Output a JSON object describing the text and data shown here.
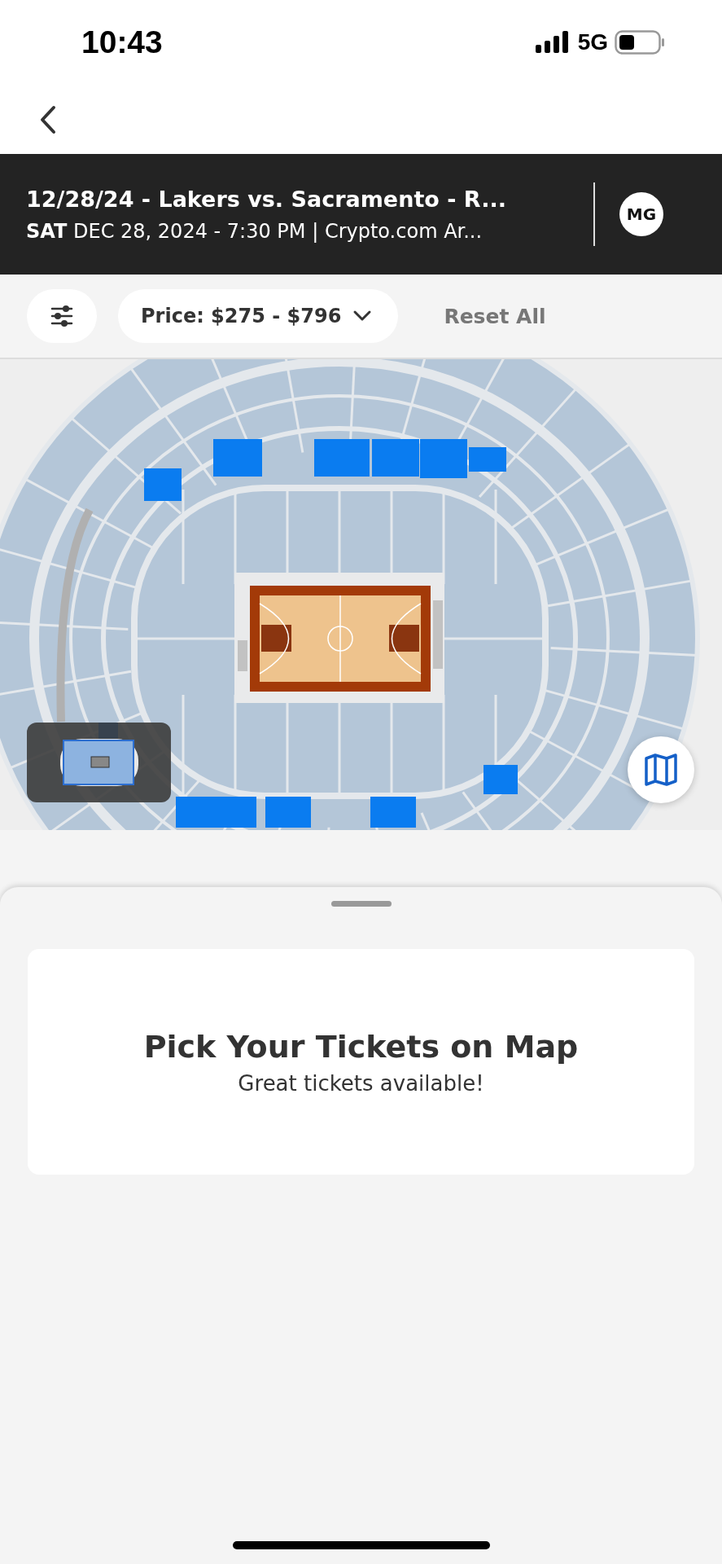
{
  "status_bar": {
    "time": "10:43",
    "network": "5G"
  },
  "event": {
    "title": "12/28/24 - Lakers vs. Sacramento - R...",
    "day": "SAT",
    "details": "DEC 28, 2024 - 7:30 PM | Crypto.com Ar...",
    "avatar": "MG"
  },
  "filters": {
    "price": "Price: $275 - $796",
    "reset": "Reset All"
  },
  "sheet": {
    "heading": "Pick Your Tickets on Map",
    "subheading": "Great tickets available!"
  }
}
